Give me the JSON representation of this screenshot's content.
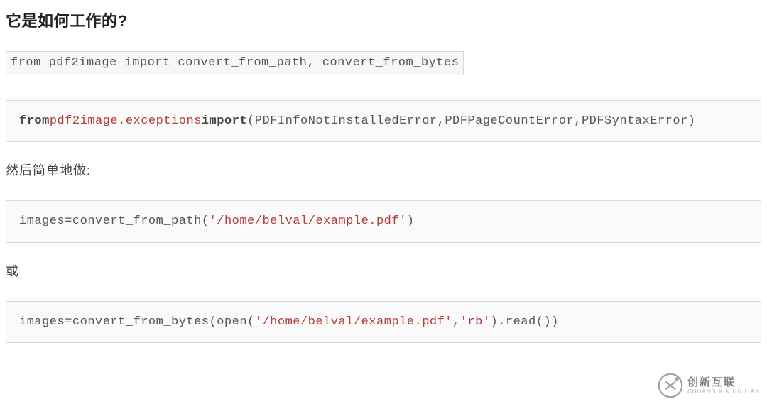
{
  "heading": "它是如何工作的?",
  "code1": "from pdf2image import convert_from_path, convert_from_bytes",
  "code2": {
    "kw1": "from",
    "pkg": "pdf2image.exceptions",
    "kw2": "import",
    "rest": "(PDFInfoNotInstalledError,PDFPageCountError,PDFSyntaxError)"
  },
  "para1": "然后简单地做:",
  "code3": {
    "pre": "images=convert_from_path(",
    "str": "'/home/belval/example.pdf'",
    "post": ")"
  },
  "para2": "或",
  "code4": {
    "pre": "images=convert_from_bytes(open(",
    "str1": "'/home/belval/example.pdf'",
    "mid": ",",
    "str2": "'rb'",
    "post": ").read())"
  },
  "watermark": {
    "cn": "创新互联",
    "en": "CHUANG XIN HU LIAN"
  }
}
